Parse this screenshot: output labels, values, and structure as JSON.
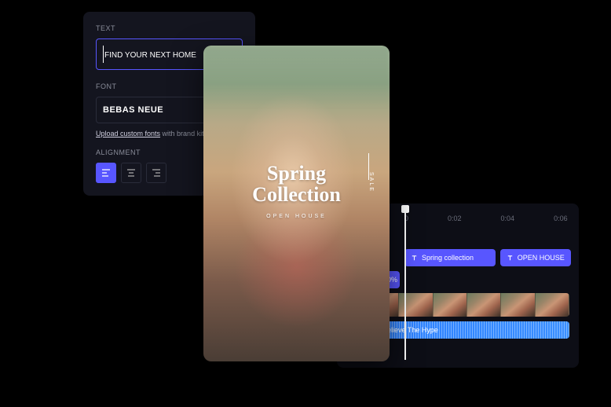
{
  "textPanel": {
    "sections": {
      "text": "TEXT",
      "font": "FONT",
      "alignment": "ALIGNMENT"
    },
    "textValue": "FIND YOUR NEXT HOME",
    "fontName": "BEBAS NEUE",
    "uploadLinkUnderlined": "Upload custom fonts",
    "uploadLinkRest": " with brand kit"
  },
  "preview": {
    "titleLine1": "Spring",
    "titleLine2": "Collection",
    "subtitle": "OPEN HOUSE",
    "sideText": "SALE"
  },
  "timeline": {
    "ruler": [
      "0",
      "0:02",
      "0:04",
      "0:06"
    ],
    "clipSpring": "Spring collection",
    "clipOpen": "OPEN HOUSE",
    "clipZoom": "100%",
    "audioName": "Believe The Hype"
  }
}
